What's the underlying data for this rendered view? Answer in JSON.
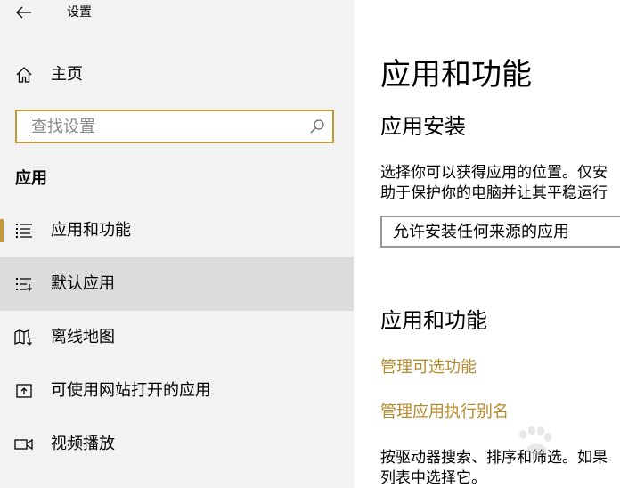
{
  "window": {
    "title": "设置"
  },
  "sidebar": {
    "home_label": "主页",
    "search": {
      "placeholder": "查找设置"
    },
    "section_heading": "应用",
    "items": [
      {
        "label": "应用和功能",
        "icon": "apps-list-icon",
        "active": true
      },
      {
        "label": "默认应用",
        "icon": "default-apps-icon",
        "hover": true
      },
      {
        "label": "离线地图",
        "icon": "offline-map-icon"
      },
      {
        "label": "可使用网站打开的应用",
        "icon": "website-apps-icon"
      },
      {
        "label": "视频播放",
        "icon": "video-icon"
      }
    ]
  },
  "content": {
    "page_title": "应用和功能",
    "install_heading": "应用安装",
    "install_desc_line1": "选择你可以获得应用的位置。仅安",
    "install_desc_line2": "助于保护你的电脑并让其平稳运行",
    "install_dropdown_value": "允许安装任何来源的应用",
    "features_heading": "应用和功能",
    "link_optional_features": "管理可选功能",
    "link_exec_alias": "管理应用执行别名",
    "search_desc_line1": "按驱动器搜索、排序和筛选。如果",
    "search_desc_line2": "列表中选择它。"
  },
  "colors": {
    "accent": "#c39a3a",
    "link": "#b58a2a",
    "sidebar_bg": "#f2f2f2",
    "hover_bg": "#dcdcdc"
  }
}
